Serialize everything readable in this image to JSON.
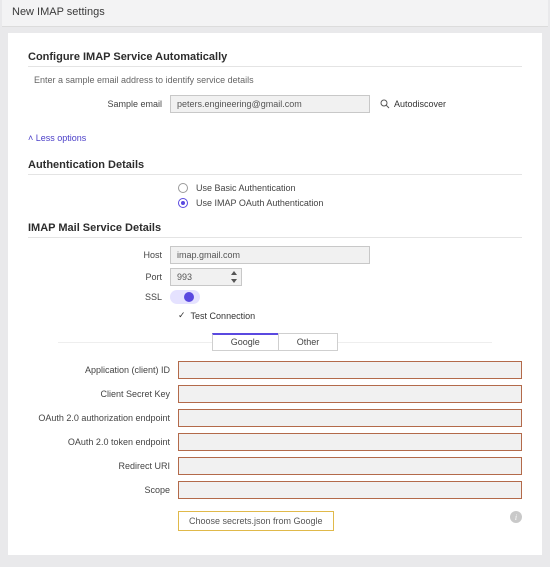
{
  "page_title": "New IMAP settings",
  "configure": {
    "heading": "Configure IMAP Service Automatically",
    "hint": "Enter a sample email address to identify service details",
    "sample_label": "Sample email",
    "sample_value": "peters.engineering@gmail.com",
    "autodiscover": "Autodiscover"
  },
  "less_options": "˄ Less options",
  "auth": {
    "heading": "Authentication Details",
    "basic": "Use Basic Authentication",
    "oauth": "Use IMAP OAuth Authentication"
  },
  "mail": {
    "heading": "IMAP Mail Service Details",
    "host_label": "Host",
    "host_value": "imap.gmail.com",
    "port_label": "Port",
    "port_value": "993",
    "ssl_label": "SSL",
    "test": "Test Connection"
  },
  "tabs": {
    "google": "Google",
    "other": "Other"
  },
  "oauth_form": {
    "client_id": "Application (client) ID",
    "secret": "Client Secret Key",
    "auth_ep": "OAuth 2.0 authorization endpoint",
    "token_ep": "OAuth 2.0 token endpoint",
    "redirect": "Redirect URI",
    "scope": "Scope",
    "secrets_btn": "Choose secrets.json from Google"
  }
}
